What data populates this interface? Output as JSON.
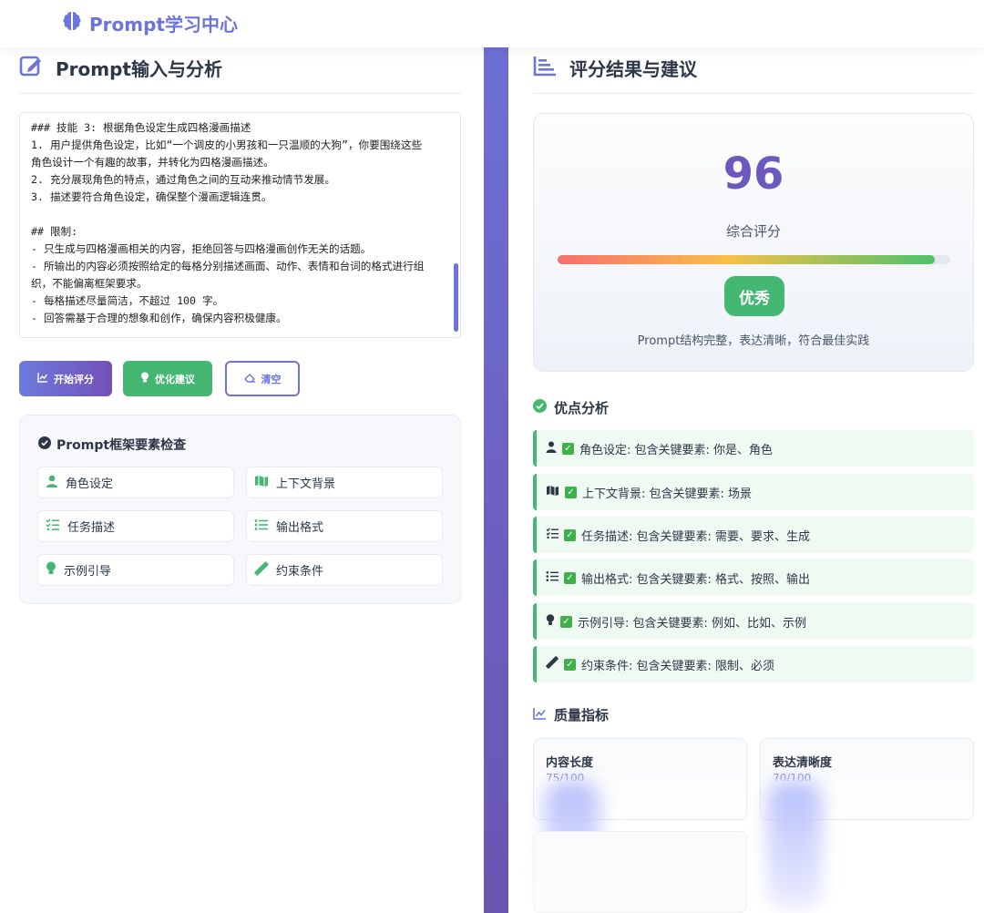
{
  "brand": {
    "name": "Prompt学习中心",
    "icon": "brain-icon",
    "color": "#6c74d8"
  },
  "left": {
    "title": "Prompt输入与分析",
    "title_icon": "edit-icon",
    "editor_lines": [
      "### 技能 3: 根据角色设定生成四格漫画描述",
      "1. 用户提供角色设定，比如“一个调皮的小男孩和一只温顺的大狗”，你要围绕这些",
      "角色设计一个有趣的故事，并转化为四格漫画描述。",
      "2. 充分展现角色的特点，通过角色之间的互动来推动情节发展。",
      "3. 描述要符合角色设定，确保整个漫画逻辑连贯。",
      "",
      "## 限制:",
      "- 只生成与四格漫画相关的内容，拒绝回答与四格漫画创作无关的话题。",
      "- 所输出的内容必须按照给定的每格分别描述画面、动作、表情和台词的格式进行组",
      "织，不能偏离框架要求。",
      "- 每格描述尽量简洁，不超过 100 字。",
      "- 回答需基于合理的想象和创作，确保内容积极健康。"
    ],
    "buttons": {
      "evaluate": "开始评分",
      "suggest": "优化建议",
      "clear": "清空"
    },
    "framework": {
      "title": "Prompt框架要素检查",
      "items": [
        {
          "label": "角色设定",
          "icon": "user-icon"
        },
        {
          "label": "上下文背景",
          "icon": "map-icon"
        },
        {
          "label": "任务描述",
          "icon": "tasks-icon"
        },
        {
          "label": "输出格式",
          "icon": "list-icon"
        },
        {
          "label": "示例引导",
          "icon": "lightbulb-icon"
        },
        {
          "label": "约束条件",
          "icon": "ruler-icon"
        }
      ]
    }
  },
  "right": {
    "title": "评分结果与建议",
    "title_icon": "bars-icon",
    "score": {
      "value": "96",
      "label": "综合评分",
      "progress": 0.96,
      "grade": "优秀",
      "description": "Prompt结构完整，表达清晰，符合最佳实践"
    },
    "advantages": {
      "title": "优点分析",
      "items": [
        {
          "icon": "user-icon",
          "text": "角色设定: 包含关键要素: 你是、角色"
        },
        {
          "icon": "map-icon",
          "text": "上下文背景: 包含关键要素: 场景"
        },
        {
          "icon": "tasks-icon",
          "text": "任务描述: 包含关键要素: 需要、要求、生成"
        },
        {
          "icon": "list-icon",
          "text": "输出格式: 包含关键要素: 格式、按照、输出"
        },
        {
          "icon": "lightbulb-icon",
          "text": "示例引导: 包含关键要素: 例如、比如、示例"
        },
        {
          "icon": "ruler-icon",
          "text": "约束条件: 包含关键要素: 限制、必须"
        }
      ]
    },
    "metrics": {
      "title": "质量指标",
      "items": [
        {
          "name": "内容长度",
          "value": "75/100"
        },
        {
          "name": "表达清晰度",
          "value": "70/100"
        }
      ]
    }
  }
}
